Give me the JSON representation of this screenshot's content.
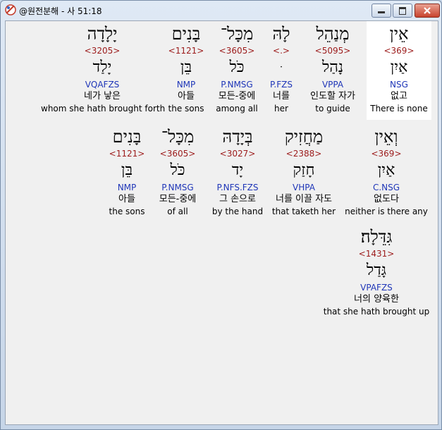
{
  "window": {
    "title": "@원전분해 - 사 51:18",
    "icons": {
      "app": "app-logo-icon",
      "minimize": "minimize-icon",
      "maximize": "maximize-icon",
      "close": "close-icon"
    }
  },
  "words": [
    {
      "heb": "אֵין",
      "strong": "<369>",
      "lemma": "אַיִן",
      "morph": "NSG",
      "kor": "없고",
      "eng": "There is none",
      "highlight": true
    },
    {
      "heb": "מְנַהֵל",
      "strong": "<5095>",
      "lemma": "נָהַל",
      "morph": "VPPA",
      "kor": "인도할 자가",
      "eng": "to guide"
    },
    {
      "heb": "לָהּ",
      "strong": "<.>",
      "lemma": "ּ",
      "morph": "P.FZS",
      "kor": "너를",
      "eng": "her"
    },
    {
      "heb": "מִכָּל־",
      "strong": "<3605>",
      "lemma": "כֹּל",
      "morph": "P.NMSG",
      "kor": "모든-중에",
      "eng": "among all"
    },
    {
      "heb": "בָּנִים",
      "strong": "<1121>",
      "lemma": "בֵּן",
      "morph": "NMP",
      "kor": "아들",
      "eng": "the sons"
    },
    {
      "heb": "יָלָדָה",
      "strong": "<3205>",
      "lemma": "יָלַד",
      "morph": "VQAFZS",
      "kor": "네가 낳은",
      "eng": "whom she hath brought forth"
    },
    {
      "heb": "וְאֵין",
      "strong": "<369>",
      "lemma": "אַיִן",
      "morph": "C.NSG",
      "kor": "없도다",
      "eng": "neither is there any"
    },
    {
      "heb": "מַחֲזִיק",
      "strong": "<2388>",
      "lemma": "חָזַק",
      "morph": "VHPA",
      "kor": "너를 이끌 자도",
      "eng": "that taketh her"
    },
    {
      "heb": "בְּיָדָהּ",
      "strong": "<3027>",
      "lemma": "יָד",
      "morph": "P.NFS.FZS",
      "kor": "그 손으로",
      "eng": "by the hand"
    },
    {
      "heb": "מִכָּל־",
      "strong": "<3605>",
      "lemma": "כֹּל",
      "morph": "P.NMSG",
      "kor": "모든-중에",
      "eng": "of all"
    },
    {
      "heb": "בָּנִים",
      "strong": "<1121>",
      "lemma": "בֵּן",
      "morph": "NMP",
      "kor": "아들",
      "eng": "the sons"
    },
    {
      "heb": "גִּדֵּלָה׃",
      "strong": "<1431>",
      "lemma": "גָּדַל",
      "morph": "VPAFZS",
      "kor": "너의 양육한",
      "eng": "that she hath brought up"
    }
  ]
}
